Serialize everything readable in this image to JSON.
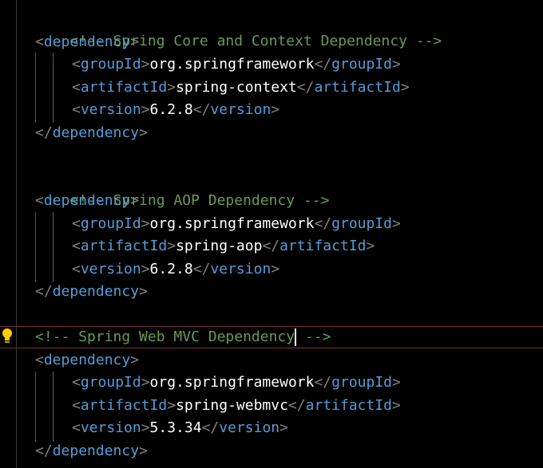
{
  "editor": {
    "blocks": [
      {
        "comment": "<!-- Spring Core and Context Dependency -->",
        "open_tag": "dependency",
        "groupId": "org.springframework",
        "artifactId": "spring-context",
        "version": "6.2.8",
        "close_tag": "dependency"
      },
      {
        "comment": "<!-- Spring AOP Dependency -->",
        "open_tag": "dependency",
        "groupId": "org.springframework",
        "artifactId": "spring-aop",
        "version": "6.2.8",
        "close_tag": "dependency"
      },
      {
        "comment_before_cursor": "<!-- Spring Web MVC Dependency",
        "comment_after_cursor": " -->",
        "open_tag": "dependency",
        "groupId": "org.springframework",
        "artifactId": "spring-webmvc",
        "version": "5.3.34",
        "close_tag": "dependency"
      }
    ],
    "tag_names": {
      "groupId": "groupId",
      "artifactId": "artifactId",
      "version": "version"
    },
    "lightbulb_icon": "lightbulb-icon",
    "colors": {
      "comment": "#6a9955",
      "tag": "#569cd6",
      "punctuation": "#808080",
      "text": "#ffffff",
      "current_line_border": "#7a2e2e",
      "lightbulb": "#ffcc00"
    }
  }
}
